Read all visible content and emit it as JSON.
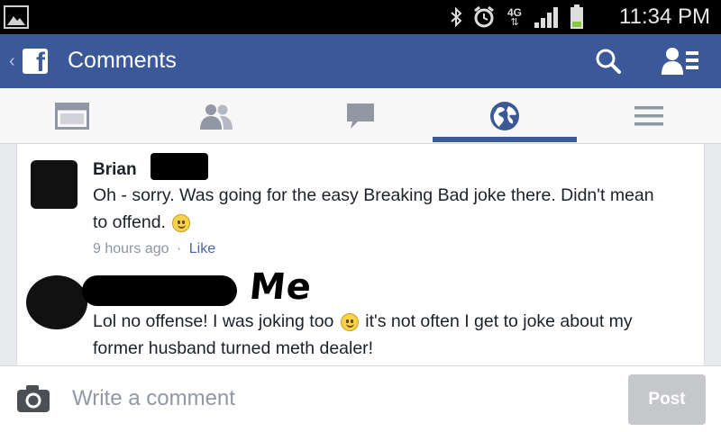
{
  "status_bar": {
    "network_label": "4G",
    "time": "11:34 PM",
    "icons": [
      "gallery-icon",
      "bluetooth-icon",
      "alarm-icon",
      "signal-icon",
      "battery-icon"
    ]
  },
  "header": {
    "title": "Comments",
    "back_glyph": "‹",
    "logo_glyph": "f",
    "icons": [
      "facebook-logo-icon",
      "search-icon",
      "friend-requests-icon"
    ],
    "brand_color": "#3b5998"
  },
  "tabs": [
    {
      "icon": "news-feed-icon",
      "active": false
    },
    {
      "icon": "friends-icon",
      "active": false
    },
    {
      "icon": "messages-icon",
      "active": false
    },
    {
      "icon": "globe-icon",
      "active": true
    },
    {
      "icon": "menu-icon",
      "active": false
    }
  ],
  "comments": [
    {
      "name": "Brian",
      "text_before": "Oh - sorry. Was going for the easy Breaking Bad joke there. Didn't mean to offend.",
      "emoji": "smirk-icon",
      "text_after": "",
      "timestamp": "9 hours ago",
      "separator": "·",
      "like_label": "Like"
    },
    {
      "name_annotation": "Me",
      "text_before": "Lol no offense! I was joking too",
      "emoji": "smiley-icon",
      "text_after": "it's not often I get to joke about my former husband turned meth dealer!"
    }
  ],
  "composer": {
    "placeholder": "Write a comment",
    "post_label": "Post",
    "camera_icon": "camera-icon"
  }
}
